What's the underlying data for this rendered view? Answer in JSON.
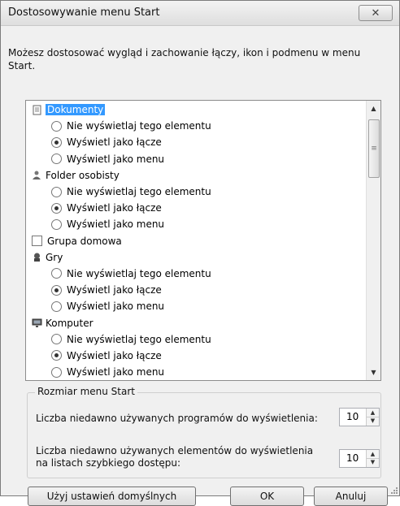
{
  "window": {
    "title": "Dostosowywanie menu Start",
    "close_icon": "close-x-icon"
  },
  "description": "Możesz dostosować wygląd i zachowanie łączy, ikon i podmenu w menu Start.",
  "list": {
    "items": [
      {
        "kind": "category",
        "label": "Dokumenty",
        "icon": "documents-icon",
        "selected": true
      },
      {
        "kind": "option",
        "label": "Nie wyświetlaj tego elementu",
        "checked": false
      },
      {
        "kind": "option",
        "label": "Wyświetl jako łącze",
        "checked": true
      },
      {
        "kind": "option",
        "label": "Wyświetl jako menu",
        "checked": false
      },
      {
        "kind": "category",
        "label": "Folder osobisty",
        "icon": "personal-folder-icon",
        "selected": false
      },
      {
        "kind": "option",
        "label": "Nie wyświetlaj tego elementu",
        "checked": false
      },
      {
        "kind": "option",
        "label": "Wyświetl jako łącze",
        "checked": true
      },
      {
        "kind": "option",
        "label": "Wyświetl jako menu",
        "checked": false
      },
      {
        "kind": "checkbox",
        "label": "Grupa domowa",
        "checked": false
      },
      {
        "kind": "category",
        "label": "Gry",
        "icon": "games-icon",
        "selected": false
      },
      {
        "kind": "option",
        "label": "Nie wyświetlaj tego elementu",
        "checked": false
      },
      {
        "kind": "option",
        "label": "Wyświetl jako łącze",
        "checked": true
      },
      {
        "kind": "option",
        "label": "Wyświetl jako menu",
        "checked": false
      },
      {
        "kind": "category",
        "label": "Komputer",
        "icon": "computer-icon",
        "selected": false
      },
      {
        "kind": "option",
        "label": "Nie wyświetlaj tego elementu",
        "checked": false
      },
      {
        "kind": "option",
        "label": "Wyświetl jako łącze",
        "checked": true
      },
      {
        "kind": "option",
        "label": "Wyświetl jako menu",
        "checked": false
      }
    ]
  },
  "start_size": {
    "legend": "Rozmiar menu Start",
    "recent_programs_label": "Liczba niedawno używanych programów do wyświetlenia:",
    "recent_programs_value": "10",
    "jump_list_label_line1": "Liczba niedawno używanych elementów do wyświetlenia",
    "jump_list_label_line2": "na listach szybkiego dostępu:",
    "jump_list_value": "10"
  },
  "buttons": {
    "defaults": "Użyj ustawień domyślnych",
    "ok": "OK",
    "cancel": "Anuluj"
  }
}
